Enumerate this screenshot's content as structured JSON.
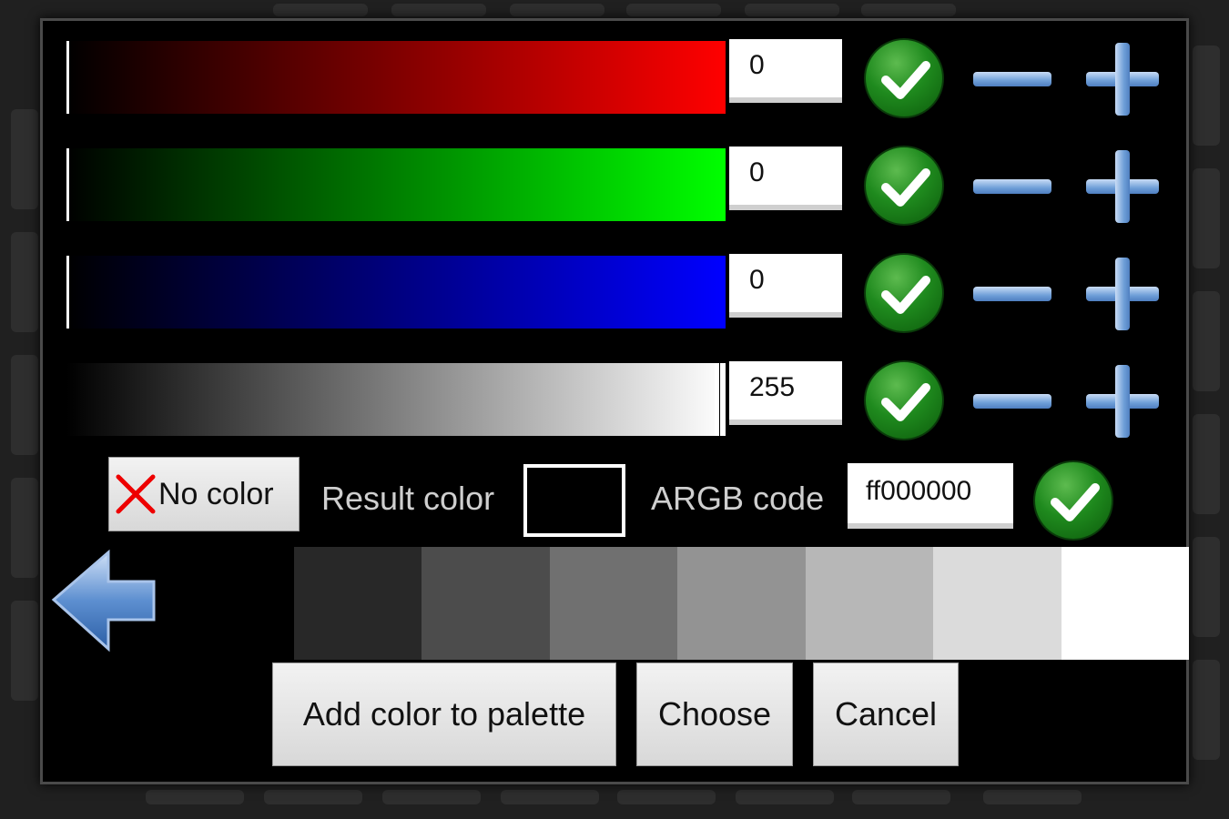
{
  "sliders": [
    {
      "name": "red",
      "value": "0"
    },
    {
      "name": "green",
      "value": "0"
    },
    {
      "name": "blue",
      "value": "0"
    },
    {
      "name": "alpha",
      "value": "255"
    }
  ],
  "no_color_label": "No color",
  "result_color_label": "Result color",
  "result_color": "#000000",
  "argb_label": "ARGB code",
  "argb_value": "ff000000",
  "palette": [
    "#000000",
    "#282828",
    "#4c4c4c",
    "#707070",
    "#939393",
    "#b7b7b7",
    "#dbdbdb",
    "#ffffff"
  ],
  "buttons": {
    "add_to_palette": "Add color to palette",
    "choose": "Choose",
    "cancel": "Cancel"
  },
  "icons": {
    "confirm": "check-icon",
    "decrease": "minus-icon",
    "increase": "plus-icon",
    "back": "back-arrow-icon",
    "clear": "red-x-icon"
  }
}
